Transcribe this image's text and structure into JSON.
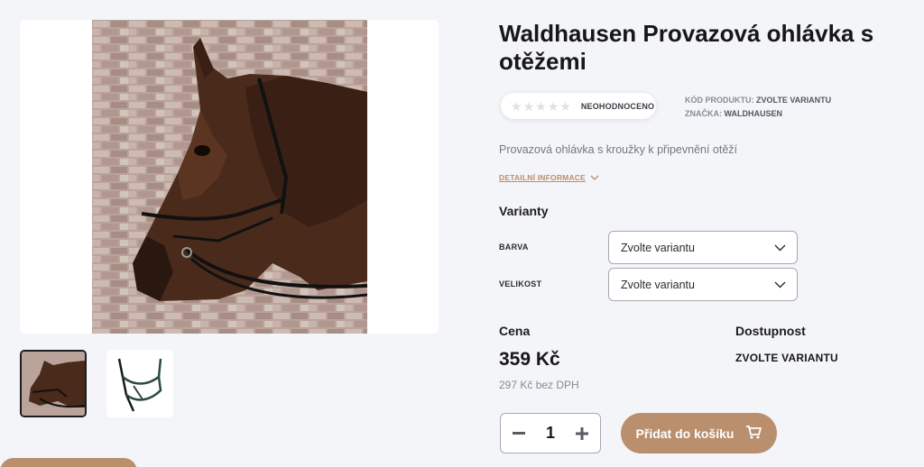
{
  "product": {
    "title": "Waldhausen Provazová ohlávka s otěžemi",
    "rating_text": "NEOHODNOCENO",
    "rating_value": 0,
    "rating_max": 5,
    "code_label": "KÓD PRODUKTU:",
    "code_value": "ZVOLTE VARIANTU",
    "brand_label": "ZNAČKA:",
    "brand_value": "WALDHAUSEN",
    "description": "Provazová ohlávka s kroužky k připevnění otěží",
    "detail_link": "DETAILNÍ INFORMACE"
  },
  "variants": {
    "heading": "Varianty",
    "items": [
      {
        "label": "BARVA",
        "value": "Zvolte variantu"
      },
      {
        "label": "VELIKOST",
        "value": "Zvolte variantu"
      }
    ]
  },
  "pricing": {
    "price_heading": "Cena",
    "price": "359 Kč",
    "price_net": "297 Kč bez DPH",
    "availability_heading": "Dostupnost",
    "availability": "ZVOLTE VARIANTU"
  },
  "cart": {
    "quantity": "1",
    "add_label": "Přidat do košíku",
    "minus_icon": "minus-icon",
    "plus_icon": "plus-icon",
    "cart_icon": "cart-icon"
  },
  "colors": {
    "accent": "#b98f6e",
    "background": "#f4f5f8"
  }
}
